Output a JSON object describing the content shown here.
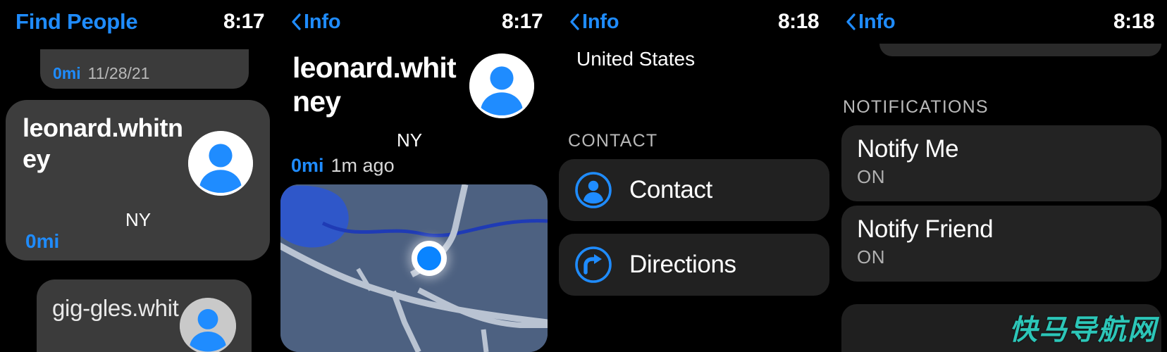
{
  "panels": [
    {
      "id": "find-people-list",
      "nav": {
        "title": "Find People",
        "clock": "8:17"
      },
      "partial_top_card": {
        "distance": "0mi",
        "date": "11/28/21"
      },
      "selected_card": {
        "name": "leonard.whitney",
        "region": "NY",
        "distance": "0mi",
        "avatar": "person-avatar-icon"
      },
      "partial_bottom_card": {
        "name": "gig-gles.whit",
        "avatar": "person-avatar-icon"
      }
    },
    {
      "id": "person-detail-map",
      "nav": {
        "back_label": "Info",
        "back_icon": "chevron-left-icon",
        "clock": "8:17"
      },
      "name": "leonard.whitney",
      "region": "NY",
      "distance": "0mi",
      "updated": "1m ago",
      "avatar": "person-avatar-icon",
      "map": {
        "user_location_marker": "blue-location-dot",
        "water_color": "#2f57c9",
        "land_color": "#4d6181",
        "road_color": "#b9c3d2"
      }
    },
    {
      "id": "person-detail-actions",
      "nav": {
        "back_label": "Info",
        "back_icon": "chevron-left-icon",
        "clock": "8:18"
      },
      "country": "United States",
      "section_header": "CONTACT",
      "actions": [
        {
          "label": "Contact",
          "icon": "contact-person-circle-icon"
        },
        {
          "label": "Directions",
          "icon": "directions-arrow-circle-icon"
        }
      ]
    },
    {
      "id": "person-detail-notifications",
      "nav": {
        "back_label": "Info",
        "back_icon": "chevron-left-icon",
        "clock": "8:18"
      },
      "section_header": "NOTIFICATIONS",
      "rows": [
        {
          "title": "Notify Me",
          "state": "ON"
        },
        {
          "title": "Notify Friend",
          "state": "ON"
        }
      ]
    }
  ],
  "watermark": "快马导航网",
  "colors": {
    "accent_blue": "#1f8cff",
    "background": "#000000",
    "card_light": "#3d3d3d",
    "card_dark": "#232323",
    "secondary_text": "#b0b0b0",
    "watermark": "#2cc6b8"
  }
}
